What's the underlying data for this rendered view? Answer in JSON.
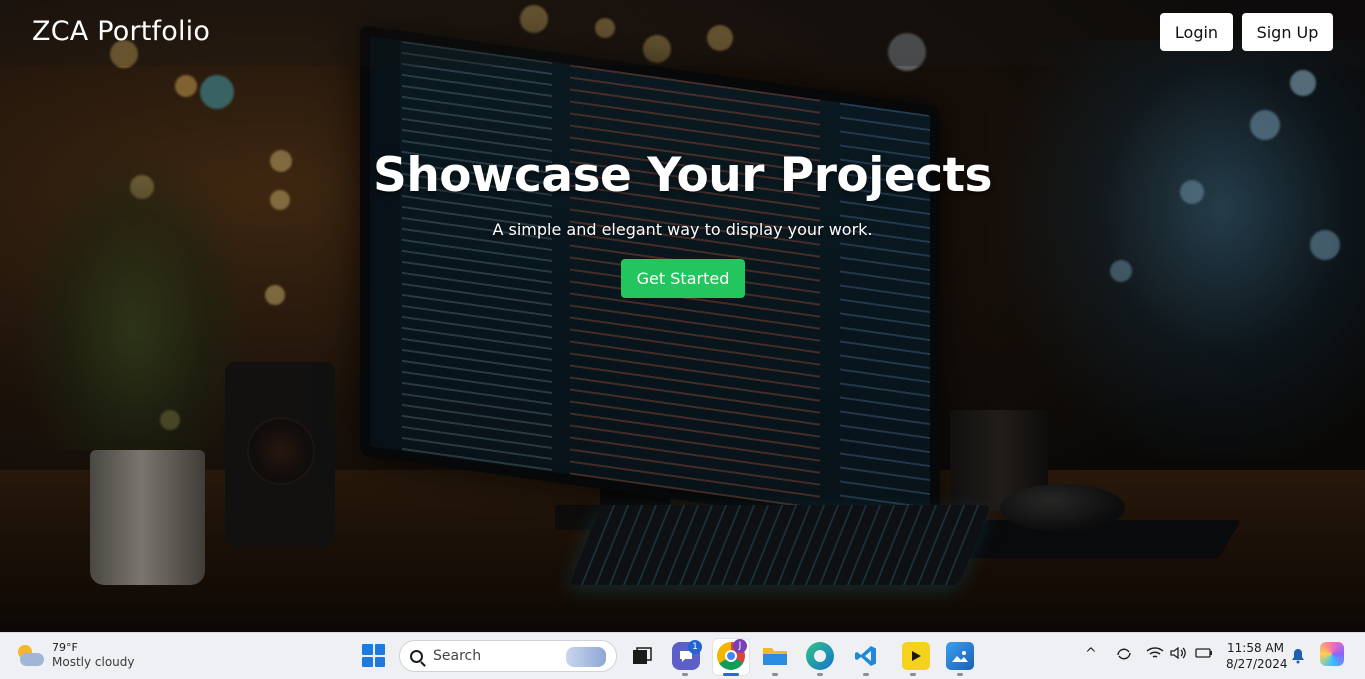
{
  "navbar": {
    "brand": "ZCA Portfolio",
    "login_label": "Login",
    "signup_label": "Sign Up"
  },
  "hero": {
    "title": "Showcase Your Projects",
    "subtitle": "A simple and elegant way to display your work.",
    "cta_label": "Get Started",
    "cta_color": "#22c55e"
  },
  "taskbar": {
    "weather": {
      "temp": "79°F",
      "condition": "Mostly cloudy",
      "icon": "partly-cloudy-icon"
    },
    "search_placeholder": "Search",
    "apps": [
      {
        "name": "task-view",
        "icon": "task-view-icon"
      },
      {
        "name": "chat",
        "icon": "chat-icon",
        "badge": "1"
      },
      {
        "name": "chrome",
        "icon": "chrome-icon",
        "badge": "J"
      },
      {
        "name": "file-explorer",
        "icon": "folder-icon"
      },
      {
        "name": "edge",
        "icon": "edge-icon"
      },
      {
        "name": "vscode",
        "icon": "vscode-icon"
      },
      {
        "name": "app-yellow",
        "icon": "yellow-app-icon"
      },
      {
        "name": "photos",
        "icon": "photos-icon"
      }
    ],
    "clock": {
      "time": "11:58 AM",
      "date": "8/27/2024"
    }
  }
}
